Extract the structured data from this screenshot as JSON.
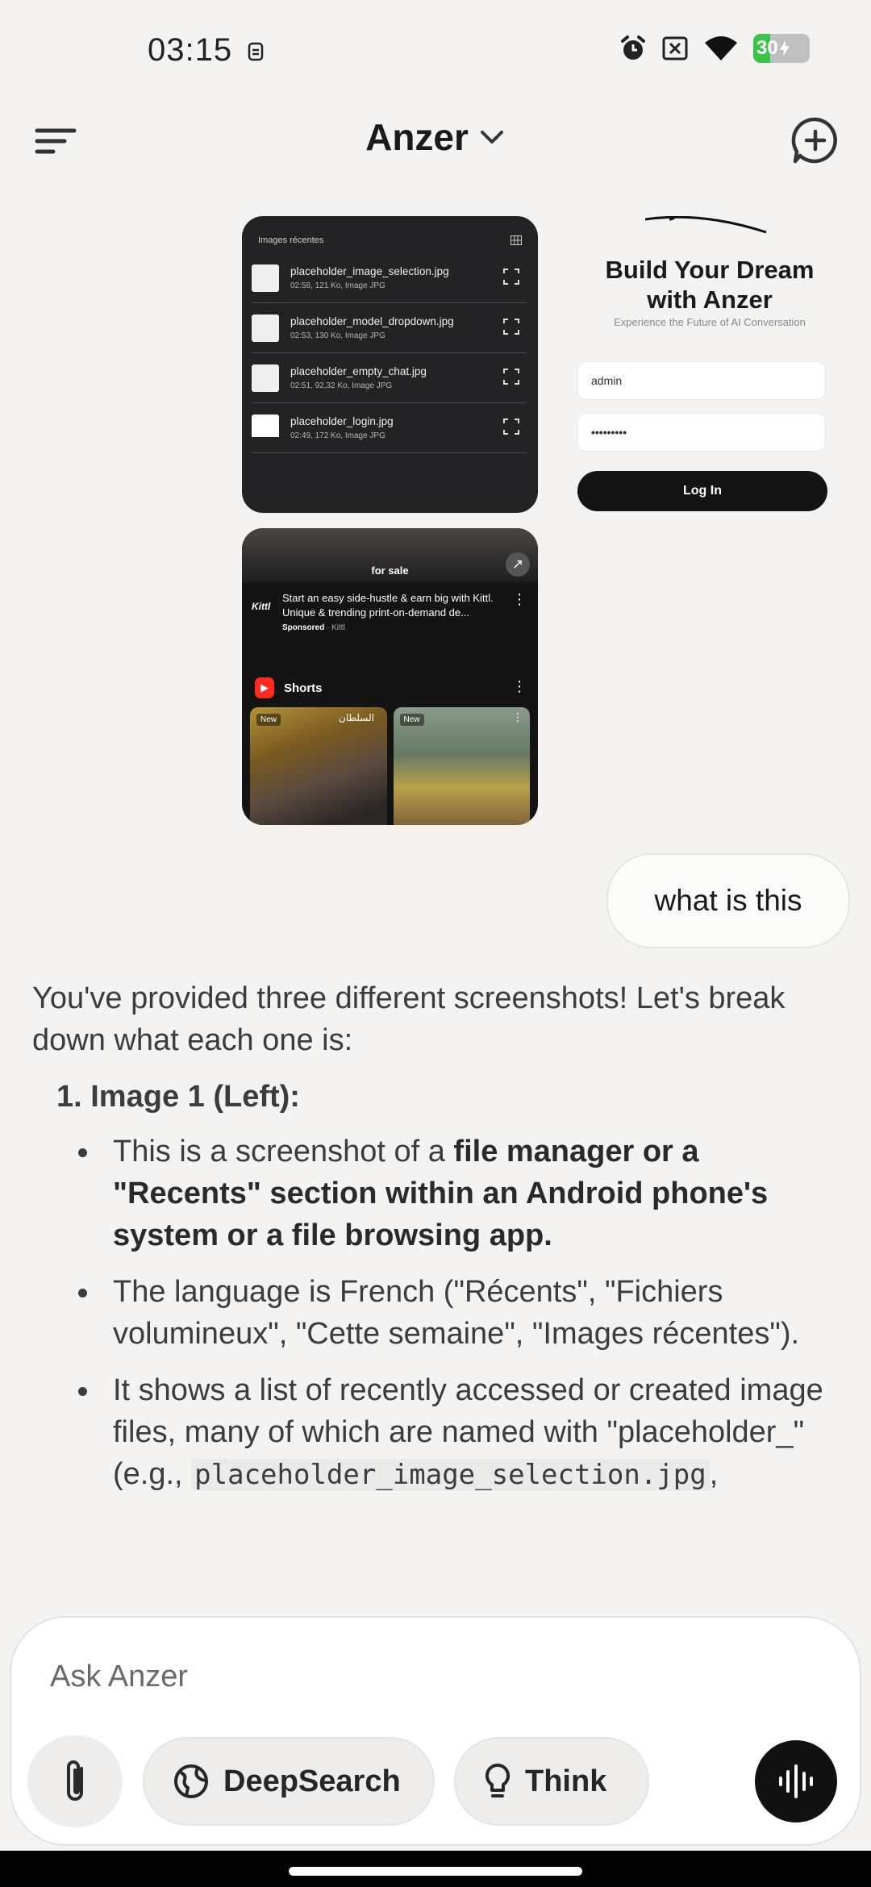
{
  "status_bar": {
    "time": "03:15",
    "battery": "30",
    "battery_level_percent": 30,
    "icons": [
      "status-face-icon",
      "alarm-icon",
      "no-sim-icon",
      "wifi-icon",
      "battery-charging-icon"
    ]
  },
  "header": {
    "title": "Anzer",
    "icons": [
      "menu-icon",
      "chevron-down-icon",
      "new-chat-icon"
    ]
  },
  "attachments": {
    "files_screenshot": {
      "header": "Images récentes",
      "files": [
        {
          "name": "placeholder_image_selection.jpg",
          "meta": "02:58, 121 Ko, Image JPG"
        },
        {
          "name": "placeholder_model_dropdown.jpg",
          "meta": "02:53, 130 Ko, Image JPG"
        },
        {
          "name": "placeholder_empty_chat.jpg",
          "meta": "02:51, 92,32 Ko, Image JPG"
        },
        {
          "name": "placeholder_login.jpg",
          "meta": "02:49, 172 Ko, Image JPG"
        }
      ]
    },
    "login_screenshot": {
      "title_line1": "Build Your Dream",
      "title_line2": "with Anzer",
      "subtitle": "Experience the Future of AI Conversation",
      "username": "admin",
      "password": "•••••••••",
      "button": "Log In"
    },
    "youtube_screenshot": {
      "banner_text": "for sale",
      "ad_logo": "Kittl",
      "ad_title": "Start an easy side-hustle & earn big with Kittl. Unique & trending print-on-demand de...",
      "ad_sponsored": "Sponsored",
      "ad_source": " · Kittl",
      "section": "Shorts",
      "badge": "New",
      "card1_text": "السلطان"
    }
  },
  "user_message": "what is this",
  "response": {
    "intro": "You've provided three different screenshots! Let's break down what each one is:",
    "item1_title": "1. Image 1 (Left):",
    "b1_prefix": "This is a screenshot of a ",
    "b1_bold": "file manager or a \"Recents\" section within an Android phone's system or a file browsing app.",
    "b2": "The language is French (\"Récents\", \"Fichiers volumineux\", \"Cette semaine\", \"Images récentes\").",
    "b3_prefix": "It shows a list of recently accessed or created image files, many of which are named with \"placeholder_\" (e.g., ",
    "b3_code": "placeholder_image_selection.jpg",
    "b3_suffix": ","
  },
  "composer": {
    "placeholder": "Ask Anzer",
    "deepsearch_label": "DeepSearch",
    "think_label": "Think",
    "icons": [
      "paperclip-icon",
      "globe-icon",
      "lightbulb-icon",
      "voice-waveform-icon"
    ]
  }
}
